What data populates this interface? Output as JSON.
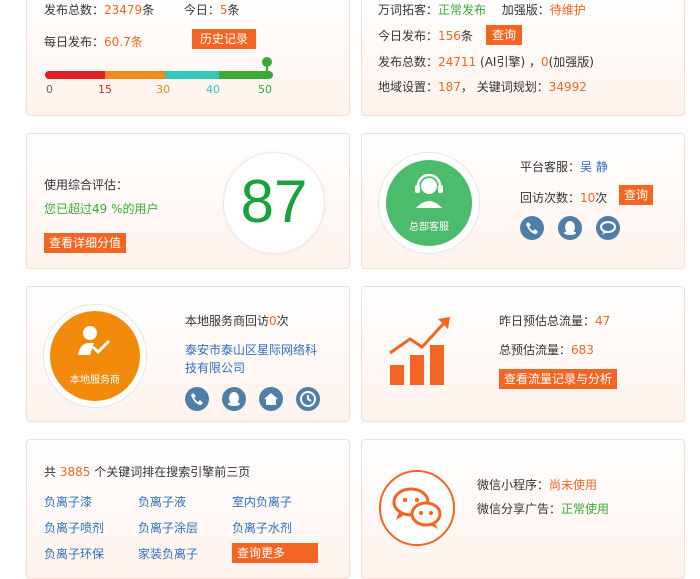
{
  "card1": {
    "total_label": "发布总数：",
    "total_value": "23479",
    "total_unit": "条",
    "today_label": "今日：",
    "today_value": "5",
    "today_unit": "条",
    "daily_label": "每日发布：",
    "daily_value": "60.7",
    "daily_unit": "条",
    "history_button": "历史记录",
    "scale_ticks": [
      "0",
      "15",
      "30",
      "40",
      "50"
    ],
    "scale_colors": [
      "#e02020",
      "#f08a1c",
      "#35c7b8",
      "#3aa935"
    ],
    "marker_value": 50
  },
  "card2": {
    "wanci_label": "万词拓客：",
    "wanci_status": "正常发布",
    "plus_label": "加强版：",
    "plus_status": "待维护",
    "today_label": "今日发布：",
    "today_value": "156",
    "today_unit": "条",
    "query_button": "查询",
    "total_label": "发布总数：",
    "total_value": "24711",
    "total_ai": " (AI引擎) ，",
    "total_plus_value": "0",
    "total_plus_label": "(加强版)",
    "region_label": "地域设置：",
    "region_value": "187",
    "keyword_label": "，  关键词规划：",
    "keyword_value": "34992"
  },
  "card3": {
    "eval_label": "使用综合评估：",
    "exceed_text": "您已超过49 %的用户",
    "detail_button": "查看详细分值",
    "score": "87"
  },
  "card4": {
    "badge_label": "总部客服",
    "service_label": "平台客服：",
    "service_name": "吴 静",
    "visit_label": "回访次数：",
    "visit_value": "10",
    "visit_unit": "次",
    "query_button": "查询"
  },
  "card5": {
    "badge_label": "本地服务商",
    "visit_prefix": "本地服务商回访",
    "visit_value": "0",
    "visit_suffix": "次",
    "company_line1": "泰安市泰山区星际网络科",
    "company_line2": "技有限公司"
  },
  "card6": {
    "yesterday_label": "昨日预估总流量：",
    "yesterday_value": "47",
    "total_label": "总预估流量：",
    "total_value": "683",
    "analysis_button": "查看流量记录与分析"
  },
  "card7": {
    "summary_prefix": "共 ",
    "summary_count": "3885",
    "summary_suffix": " 个关键词排在搜索引擎前三页",
    "keywords": [
      "负离子漆",
      "负离子液",
      "室内负离子",
      "负离子喷剂",
      "负离子涂层",
      "负离子水剂",
      "负离子环保",
      "家装负离子"
    ],
    "more_button": "查询更多"
  },
  "card8": {
    "miniprogram_label": "微信小程序：",
    "miniprogram_status": "尚未使用",
    "share_label": "微信分享广告：",
    "share_status": "正常使用"
  }
}
